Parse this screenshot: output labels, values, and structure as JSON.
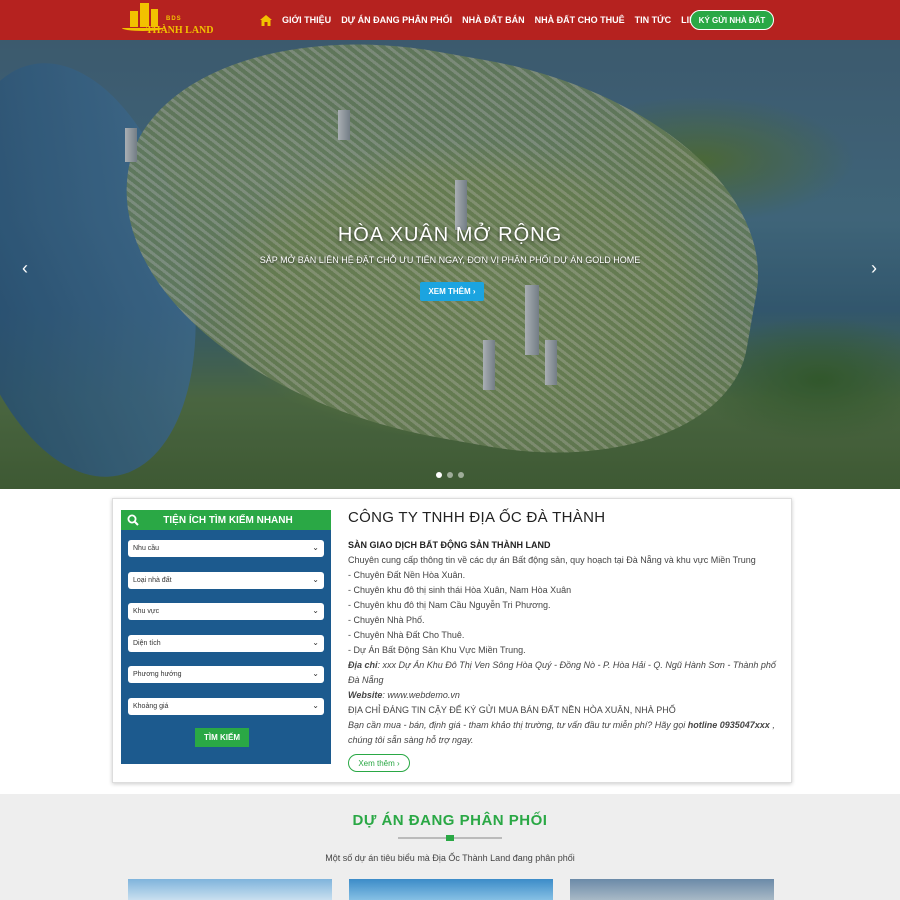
{
  "header": {
    "logo": {
      "top": "BDS",
      "name": "THÀNH LAND"
    },
    "nav": [
      "GIỚI THIỆU",
      "DỰ ÁN ĐANG PHÂN PHỐI",
      "NHÀ ĐẤT BÁN",
      "NHÀ ĐẤT CHO THUÊ",
      "TIN TỨC",
      "LIÊN HỆ"
    ],
    "cta": "KÝ GỬI NHÀ ĐẤT",
    "home_icon": "home-icon"
  },
  "hero": {
    "title": "HÒA XUÂN MỞ RỘNG",
    "subtitle": "SẮP MỞ BÁN LIÊN HỆ ĐẶT CHỖ ƯU TIÊN NGAY, ĐƠN VỊ PHÂN PHỐI DỰ ÁN GOLD HOME",
    "button": "XEM THÊM",
    "prev": "‹",
    "next": "›"
  },
  "search": {
    "title": "TIỆN ÍCH TÌM KIẾM NHANH",
    "fields": [
      "Nhu cầu",
      "Loại nhà đất",
      "Khu vực",
      "Diện tích",
      "Phương hướng",
      "Khoảng giá"
    ],
    "button": "TÌM KIẾM"
  },
  "company": {
    "title": "CÔNG TY TNHH ĐỊA ỐC ĐÀ THÀNH",
    "subtitle": "SÀN GIAO DỊCH BẤT ĐỘNG SẢN THÀNH LAND",
    "intro": "Chuyên cung cấp thông tin về các dự án Bất động sản, quy hoạch tại Đà Nẵng và khu vực Miền Trung",
    "items": [
      "- Chuyên Đất Nền Hòa Xuân.",
      "- Chuyên khu đô thị sinh thái Hòa Xuân, Nam Hòa Xuân",
      "- Chuyên khu đô thị Nam Cầu Nguyễn Tri Phương.",
      "- Chuyên Nhà Phố.",
      "- Chuyên Nhà Đất Cho Thuê.",
      "- Dự Án Bất Động Sản Khu Vực Miền Trung."
    ],
    "address_label": "Địa chỉ",
    "address_line1": ": xxx Dự Án Khu Đô Thị Ven Sông Hòa Quý - Đồng Nò - P. Hòa Hải - Q. Ngũ Hành Sơn - Thành phố",
    "address_line2": "Đà Nẵng",
    "website_label": "Website",
    "website": ": www.webdemo.vn",
    "trust": "ĐỊA CHỈ ĐÁNG TIN CẬY ĐỂ KÝ GỬI MUA BÁN ĐẤT NỀN HÒA XUÂN, NHÀ PHỐ",
    "consult_pre": "Bạn cần mua - bán, định giá - tham khảo thị trường, tư vấn đầu tư miễn phí? Hãy gọi ",
    "hotline": "hotline 0935047xxx",
    "consult_post": " ,",
    "consult_line2": "chúng tôi sẵn sàng hỗ trợ ngay.",
    "more": "Xem thêm"
  },
  "projects": {
    "title": "DỰ ÁN ĐANG PHÂN PHỐI",
    "subtitle": "Một số dự án tiêu biểu mà Địa Ốc Thành Land đang phân phối"
  },
  "colors": {
    "header": "#b5221f",
    "green": "#2aa845",
    "blue": "#1c5a8e",
    "cyan": "#1ba4e0"
  }
}
